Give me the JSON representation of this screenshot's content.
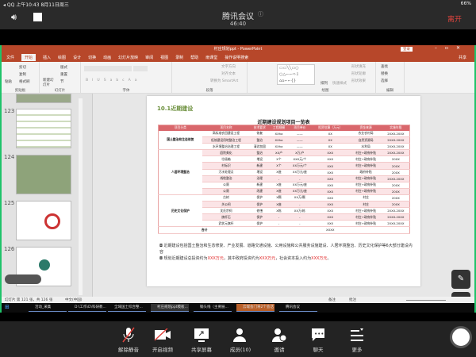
{
  "status": {
    "left": "◂ QQ  上午10:43  8月11日周三",
    "right": "66%"
  },
  "meeting": {
    "title": "腾讯会议",
    "time": "46:40",
    "leave": "离开"
  },
  "ppt": {
    "title": "村庄规划ppt - PowerPoint",
    "login": "登录",
    "share": "共享",
    "tabs": [
      "文件",
      "开始",
      "插入",
      "绘图",
      "设计",
      "切换",
      "动画",
      "幻灯片放映",
      "审阅",
      "视图",
      "录制",
      "帮助",
      "雨课堂",
      "操作说明搜索"
    ],
    "ribbon": {
      "paste": "粘贴",
      "cut": "剪切",
      "copy": "复制",
      "format": "格式刷",
      "clipboard": "剪贴板",
      "new_slide": "新建幻灯片",
      "layout": "版式",
      "reset": "重置",
      "section": "节",
      "slides": "幻灯片",
      "font": "字体",
      "paragraph": "段落",
      "text_dir": "文字方向",
      "align_text": "对齐文本",
      "smartart": "转换为 SmartArt",
      "arrange": "排列",
      "quick_styles": "快速样式",
      "fill": "形状填充",
      "outline": "形状轮廓",
      "effects": "形状效果",
      "drawing": "绘图",
      "find": "查找",
      "replace": "替换",
      "select": "选择",
      "editing": "编辑"
    },
    "thumbs": [
      "123",
      "124",
      "125",
      "126"
    ],
    "statusbar": {
      "slide": "幻灯片 第 121 张，共 126 张",
      "lang": "中文(中国)",
      "notes": "备注",
      "comments": "批注"
    }
  },
  "slide": {
    "heading": "10.1近期建设",
    "table_title": "近期建设规划项目一览表",
    "headers": [
      "项目分类",
      "项目名称",
      "技术要求",
      "工程规模",
      "项目单价",
      "投资估算（万元）",
      "资金来源",
      "实施年限"
    ],
    "categories": [
      "国土整治和生态修复",
      "人居环境整治",
      "历史文化保护"
    ],
    "rows": [
      [
        "高标准农田建设工程",
        "恢复",
        "XXha",
        "——",
        "XX",
        "农业农村局",
        "20XX-20XX"
      ],
      [
        "低效建设用地整治工程",
        "整治",
        "XXha",
        "——",
        "XX",
        "自然资源局",
        "20XX-20XX"
      ],
      [
        "水环境整治治理工程",
        "清淤加固",
        "XXha",
        "——",
        "XX",
        "水利局",
        "20XX-20XX"
      ],
      [
        "庭院美化",
        "整治",
        "XX户",
        "X万/户",
        "XXX",
        "村庄+政府补贴",
        "20XX-20XX"
      ],
      [
        "垃圾箱",
        "增设",
        "X个",
        "XXX元/个",
        "XXX",
        "村庄+政府补贴",
        "20XX"
      ],
      [
        "村标识",
        "新建",
        "X个",
        "XX万元/个",
        "XXX",
        "村庄+政府补贴",
        "20XX"
      ],
      [
        "污水处理点",
        "增设",
        "X座",
        "XX万元/座",
        "XXX",
        "政府补贴",
        "20XX"
      ],
      [
        "线缆整治",
        "治理",
        "-",
        "-",
        "XXX",
        "村庄+政府补贴",
        "20XX-20XX"
      ],
      [
        "公厕",
        "新建",
        "X座",
        "XX万元/座",
        "XXX",
        "村庄+政府补贴",
        "20XX"
      ],
      [
        "公厕",
        "改建",
        "X座",
        "XX万元/座",
        "XXX",
        "村庄+政府补贴",
        "20XX"
      ],
      [
        "古树",
        "保护",
        "X颗",
        "XX万/颗",
        "XXX",
        "村庄",
        "20XX"
      ],
      [
        "关公祠",
        "保护",
        "X座",
        "-",
        "XXX",
        "村庄",
        "20XX"
      ],
      [
        "沈氏宗祠",
        "修缮",
        "X栋",
        "XX万/栋",
        "XXX",
        "村庄+政府补贴",
        "20XX-20XX"
      ],
      [
        "旗杆石",
        "保护",
        "-",
        "-",
        "XXX",
        "村庄+政府补贴",
        "20XX-20XX"
      ],
      [
        "武状元旗杆",
        "保护",
        "-",
        "-",
        "XXX",
        "村庄+政府补贴",
        "20XX-20XX"
      ]
    ],
    "total_label": "合计",
    "total_value": "XXXX",
    "note1": "近期建设包括国土整治和生态修复、产业发展、道路交通设施、公用设施和公共服务设施建设、人居环境整治、历史文化保护等6大部分建设内容",
    "note2_a": "规划近期建设总投资约为",
    "note2_b": "XXX万元",
    "note2_c": "，其中政府投资约为",
    "note2_d": "XXX万元",
    "note2_e": "，社会资本投入约为",
    "note2_f": "XXX万元",
    "note2_g": "。"
  },
  "taskbar": [
    "活动_采集",
    "D:\\工作\\D\\科研教...",
    "全域国土综合整...",
    "村庄规划ppt模板...",
    "锄头线（主要展...",
    "云端会门将2个会话",
    "腾讯会议"
  ],
  "toolbar": [
    "解除静音",
    "开启视频",
    "共享屏幕",
    "成员(10)",
    "邀请",
    "聊天",
    "更多"
  ]
}
